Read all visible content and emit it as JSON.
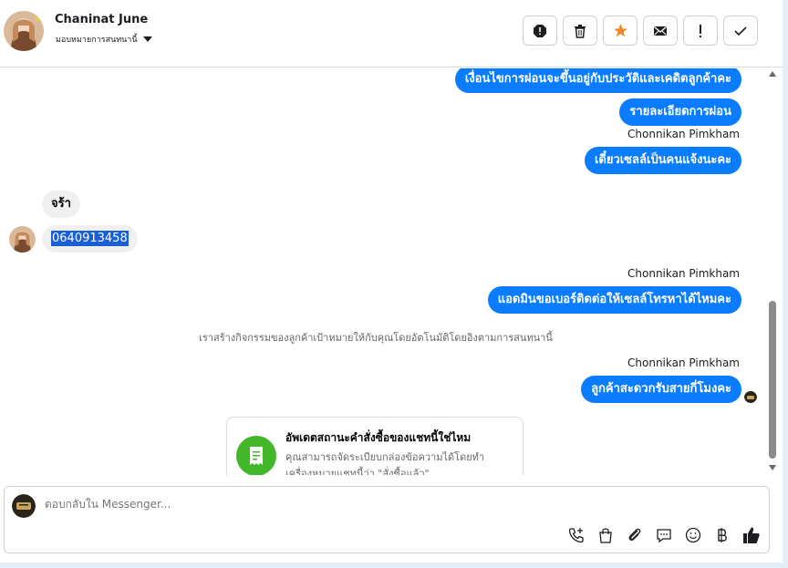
{
  "header": {
    "contact_name": "Chaninat June",
    "assign_label": "มอบหมายการสนทนานี้",
    "tools": [
      {
        "name": "spam-icon"
      },
      {
        "name": "trash-icon"
      },
      {
        "name": "star-icon",
        "color": "#f08a24"
      },
      {
        "name": "mail-icon"
      },
      {
        "name": "exclamation-icon"
      },
      {
        "name": "check-icon"
      }
    ]
  },
  "messages": {
    "m1": "เงื่อนไขการผ่อนจะขึ้นอยู่กับประวัติและเคดิตลูกค้าคะ",
    "m2": "รายละเอียดการผ่อน",
    "sender1": "Chonnikan Pimkham",
    "m3": "เดี๋ยวเซลล์เป็นคนแจ้งนะคะ",
    "in1": "จร้า",
    "in2": "0640913458",
    "sender2": "Chonnikan Pimkham",
    "m4": "แอดมินขอเบอร์ติดต่อให้เซลล์โทรหาได้ไหมคะ",
    "system_note": "เราสร้างกิจกรรมของลูกค้าเป้าหมายให้กับคุณโดยอัตโนมัติโดยอิงตามการสนทนานี้",
    "sender3": "Chonnikan Pimkham",
    "m5": "ลูกค้าสะดวกรับสายกี่โมงคะ"
  },
  "order_card": {
    "title": "อัพเดตสถานะคำสั่งซื้อของแชทนี้ใช่ไหม",
    "body": "คุณสามารถจัดระเบียบกล่องข้อความได้โดยทำเครื่องหมายแชทนี้ว่า \"สั่งซื้อแล้ว\""
  },
  "composer": {
    "placeholder": "ตอบกลับใน Messenger..."
  },
  "colors": {
    "accent": "#0a7cff",
    "incoming": "#f0f0f0",
    "order_icon": "#42b72a"
  }
}
